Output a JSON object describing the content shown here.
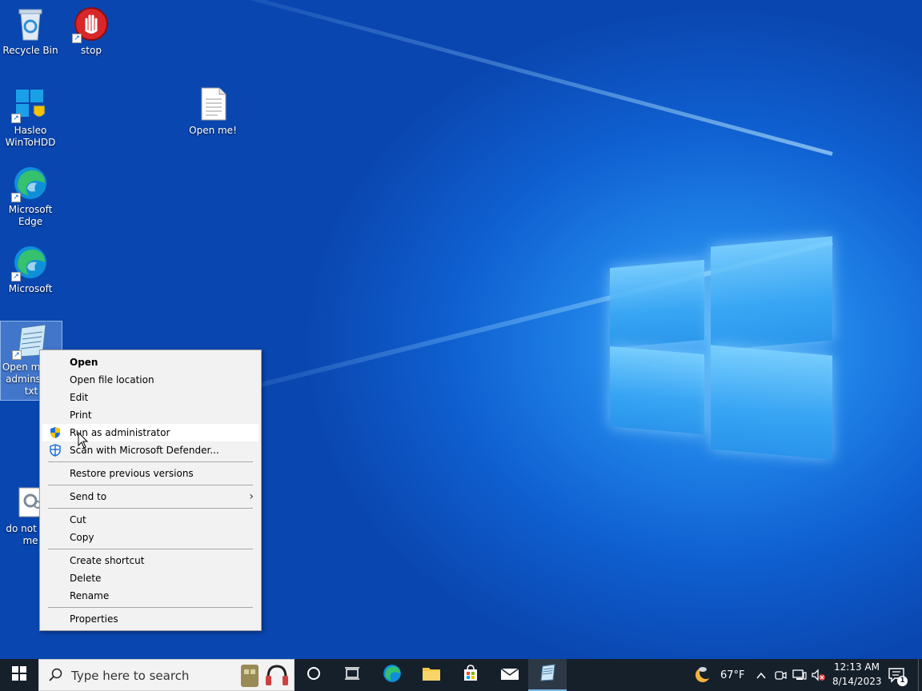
{
  "desktop_icons": [
    {
      "label": "Recycle Bin"
    },
    {
      "label": "stop"
    },
    {
      "label": "Hasleo WinToHDD"
    },
    {
      "label": "Open me!"
    },
    {
      "label": "Microsoft Edge"
    },
    {
      "label": "Microsoft"
    },
    {
      "label": "Open me as adminstr... txt"
    },
    {
      "label": "do not n... me"
    }
  ],
  "context_menu": {
    "items": [
      {
        "label": "Open"
      },
      {
        "label": "Open file location"
      },
      {
        "label": "Edit"
      },
      {
        "label": "Print"
      },
      {
        "label": "Run as administrator"
      },
      {
        "label": "Scan with Microsoft Defender..."
      },
      {
        "label": "Restore previous versions"
      },
      {
        "label": "Send to"
      },
      {
        "label": "Cut"
      },
      {
        "label": "Copy"
      },
      {
        "label": "Create shortcut"
      },
      {
        "label": "Delete"
      },
      {
        "label": "Rename"
      },
      {
        "label": "Properties"
      }
    ]
  },
  "taskbar": {
    "search_placeholder": "Type here to search",
    "weather": "67°F",
    "time": "12:13 AM",
    "date": "8/14/2023",
    "notification_count": "1"
  },
  "colors": {
    "taskbar": "#16202b",
    "menu_bg": "#f2f2f2",
    "accent": "#0f5fd0"
  }
}
